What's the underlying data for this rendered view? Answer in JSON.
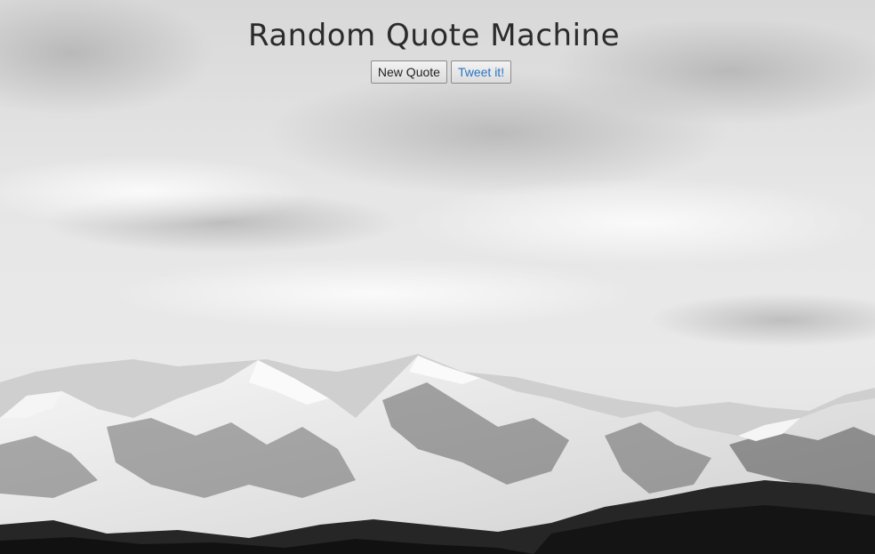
{
  "page": {
    "title": "Random Quote Machine"
  },
  "actions": {
    "new_quote_label": "New Quote",
    "tweet_label": "Tweet it!"
  },
  "colors": {
    "title": "#2b2b2b",
    "tweet_link": "#2a73c4",
    "sky": "#e6e6e6",
    "snow": "#f4f4f4",
    "rock": "#4a4a4a",
    "forest": "#1c1c1c"
  }
}
